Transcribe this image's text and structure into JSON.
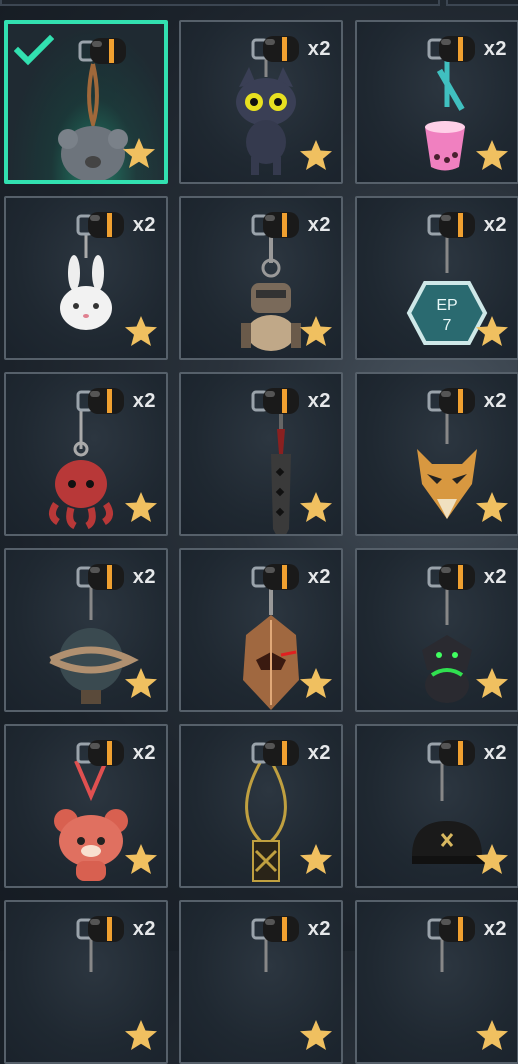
{
  "colors": {
    "accent": "#32e0b0",
    "star": "#f0c060",
    "tileBorder": "#56606a"
  },
  "selected_index": 0,
  "tiles": [
    {
      "count": "",
      "item_icon": "koala-ball-charm-icon"
    },
    {
      "count": "x2",
      "item_icon": "black-cat-charm-icon"
    },
    {
      "count": "x2",
      "item_icon": "boba-tea-charm-icon"
    },
    {
      "count": "x2",
      "item_icon": "bunny-charm-icon"
    },
    {
      "count": "x2",
      "item_icon": "robot-monkey-charm-icon"
    },
    {
      "count": "x2",
      "item_icon": "ep7-tag-charm-icon"
    },
    {
      "count": "x2",
      "item_icon": "octopus-charm-icon"
    },
    {
      "count": "x2",
      "item_icon": "blade-charm-icon"
    },
    {
      "count": "x2",
      "item_icon": "fox-mask-charm-icon"
    },
    {
      "count": "x2",
      "item_icon": "rope-globe-charm-icon"
    },
    {
      "count": "x2",
      "item_icon": "crystal-helm-charm-icon"
    },
    {
      "count": "x2",
      "item_icon": "green-dragon-charm-icon"
    },
    {
      "count": "x2",
      "item_icon": "red-panda-charm-icon"
    },
    {
      "count": "x2",
      "item_icon": "golden-knot-charm-icon"
    },
    {
      "count": "x2",
      "item_icon": "black-cap-charm-icon"
    },
    {
      "count": "x2",
      "item_icon": "charm-icon"
    },
    {
      "count": "x2",
      "item_icon": "charm-icon"
    },
    {
      "count": "x2",
      "item_icon": "charm-icon"
    }
  ]
}
